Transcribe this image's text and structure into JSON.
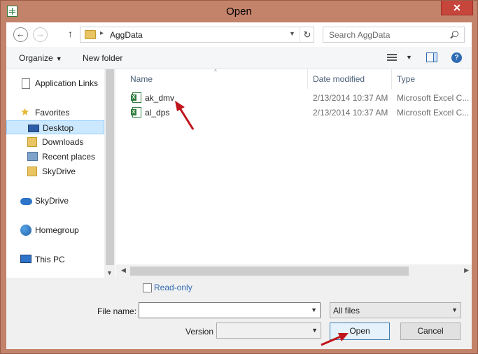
{
  "window": {
    "title": "Open",
    "close_glyph": "✕"
  },
  "address": {
    "path": "AggData",
    "separator": "▸"
  },
  "search": {
    "placeholder": "Search AggData"
  },
  "toolbar": {
    "organize": "Organize",
    "new_folder": "New folder"
  },
  "nav": {
    "application_links": "Application Links",
    "favorites": "Favorites",
    "favorites_items": [
      "Desktop",
      "Downloads",
      "Recent places",
      "SkyDrive"
    ],
    "skydrive": "SkyDrive",
    "homegroup": "Homegroup",
    "this_pc": "This PC"
  },
  "columns": {
    "name": "Name",
    "date": "Date modified",
    "type": "Type"
  },
  "files": [
    {
      "name": "ak_dmv",
      "date": "2/13/2014 10:37 AM",
      "type": "Microsoft Excel C..."
    },
    {
      "name": "al_dps",
      "date": "2/13/2014 10:37 AM",
      "type": "Microsoft Excel C..."
    }
  ],
  "bottom": {
    "readonly": "Read-only",
    "file_name_label": "File name:",
    "file_name_value": "",
    "filter": "All files",
    "version_label": "Version",
    "open": "Open",
    "cancel": "Cancel"
  },
  "icons": {
    "star_glyph": "★",
    "back_glyph": "←",
    "forward_glyph": "→",
    "up_glyph": "↑",
    "refresh_glyph": "↻",
    "caret_glyph": "▼",
    "sort_glyph": "^",
    "help_glyph": "?"
  },
  "colors": {
    "accent": "#2e6ab3",
    "titlebar": "#c3826a",
    "close": "#c7463c",
    "annotation": "#c0141c"
  }
}
